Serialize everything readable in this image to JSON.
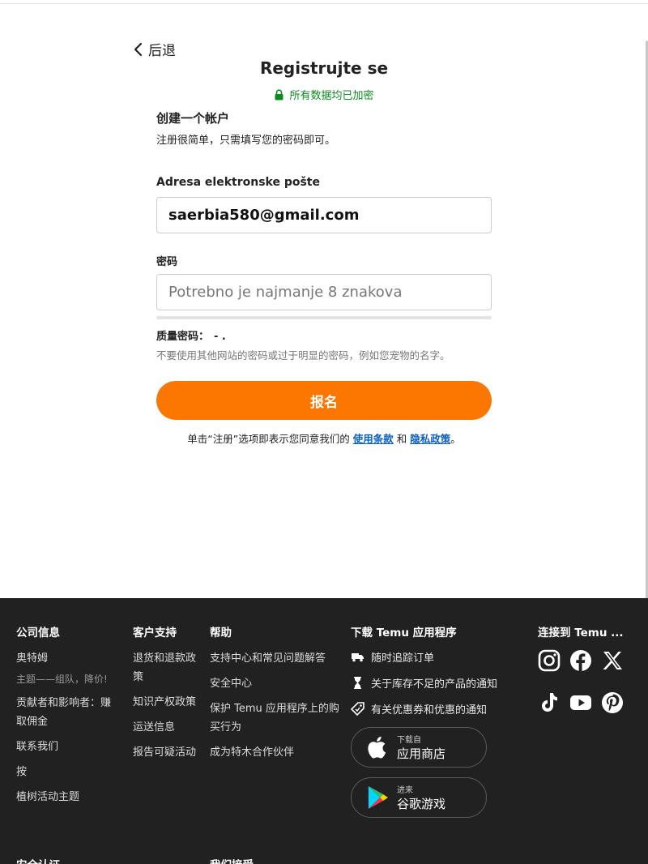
{
  "nav": {
    "back_label": "后退"
  },
  "header": {
    "title": "Registrujte se",
    "secure_text": "所有数据均已加密"
  },
  "form": {
    "heading": "创建一个帐户",
    "subheading": "注册很简单，只需填写您的密码即可。",
    "email_label": "Adresa elektronske pošte",
    "email_value": "saerbia580@gmail.com",
    "password_label": "密码",
    "password_placeholder": "Potrebno je najmanje 8 znakova",
    "strength_label": "质量密码：",
    "strength_value": "- .",
    "hint": "不要使用其他网站的密码或过于明显的密码，例如您宠物的名字。",
    "submit_label": "报名",
    "terms_prefix": "单击“注册”选项即表示您同意我们的",
    "terms_link": "使用条款",
    "terms_and": "和",
    "privacy_link": "隐私政策",
    "terms_suffix": "。"
  },
  "footer": {
    "company": {
      "heading": "公司信息",
      "items": [
        "奥特姆",
        "主题——组队，降价!",
        "贡献者和影响者：赚取佣金",
        "联系我们",
        "按",
        "植树活动主题"
      ]
    },
    "support": {
      "heading": "客户支持",
      "items": [
        "退货和退款政策",
        "知识产权政策",
        "运送信息",
        "报告可疑活动"
      ]
    },
    "help": {
      "heading": "帮助",
      "items": [
        "支持中心和常见问题解答",
        "安全中心",
        "保护 Temu 应用程序上的购买行为",
        "成为特木合作伙伴"
      ]
    },
    "app": {
      "heading": "下载 Temu 应用程序",
      "notifications": [
        "随时追踪订单",
        "关于库存不足的产品的通知",
        "有关优惠券和优惠的通知"
      ],
      "appstore_small": "下载自",
      "appstore_big": "应用商店",
      "googleplay_small": "进来",
      "googleplay_big": "谷歌游戏"
    },
    "connect": {
      "heading": "连接到 Temu ..."
    },
    "bottom": {
      "security_heading": "安全认证",
      "accept_heading": "我们接受"
    }
  },
  "colors": {
    "accent": "#fb7701",
    "secure_green": "#0a8a1f",
    "link": "#0a5ec9",
    "footer_bg": "#212121"
  }
}
